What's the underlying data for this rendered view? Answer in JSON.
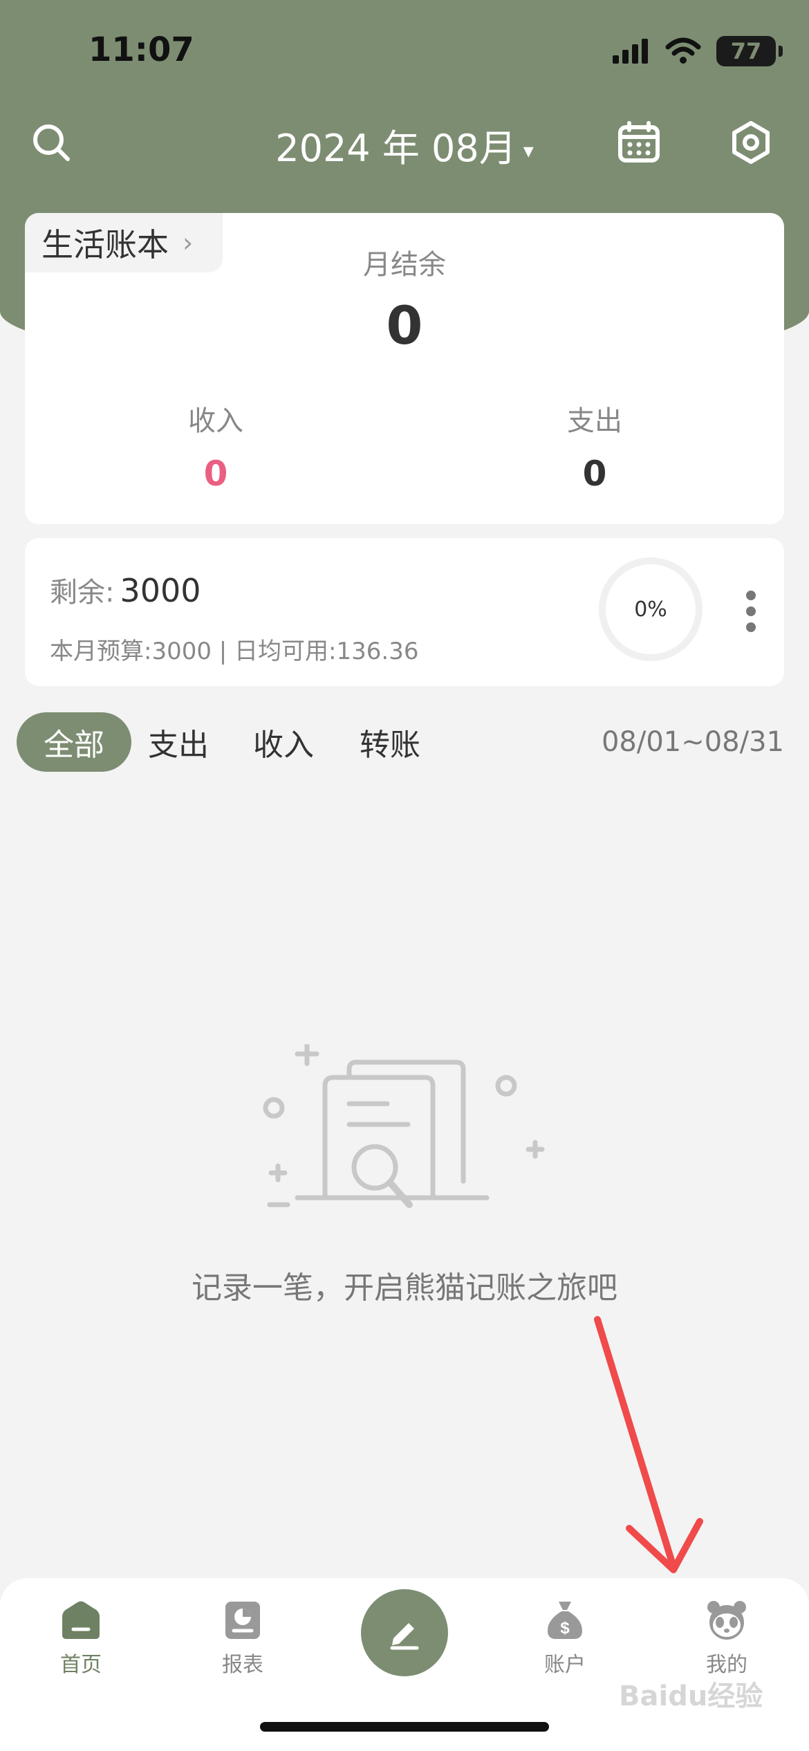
{
  "status_bar": {
    "time": "11:07",
    "battery": "77"
  },
  "header": {
    "month": "2024 年 08月",
    "caret": "▾"
  },
  "summary": {
    "book_name": "生活账本",
    "book_chevron": "›",
    "balance_label": "月结余",
    "balance_value": "0",
    "income_label": "收入",
    "income_value": "0",
    "expense_label": "支出",
    "expense_value": "0"
  },
  "budget": {
    "remain_label": "剩余:",
    "remain_value": "3000",
    "detail": "本月预算:3000 | 日均可用:136.36",
    "progress_text": "0%",
    "progress": 0
  },
  "filter": {
    "tabs": [
      "全部",
      "支出",
      "收入",
      "转账"
    ],
    "active": 0,
    "date_range": "08/01~08/31"
  },
  "empty_state": {
    "text": "记录一笔，开启熊猫记账之旅吧"
  },
  "tabbar": {
    "items": [
      {
        "label": "首页",
        "icon": "home-icon"
      },
      {
        "label": "报表",
        "icon": "report-icon"
      },
      {
        "label": "账户",
        "icon": "money-bag-icon"
      },
      {
        "label": "我的",
        "icon": "panda-icon"
      }
    ],
    "center_icon": "pencil-icon"
  },
  "colors": {
    "header": "#7d8d72",
    "income": "#e96083",
    "arrow": "#f04a4a"
  },
  "watermark": "Baidu经验"
}
